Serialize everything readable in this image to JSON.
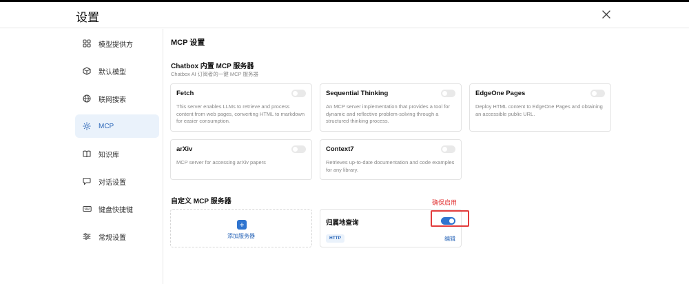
{
  "header": {
    "title": "设置",
    "close_icon": "close-icon"
  },
  "sidebar": {
    "items": [
      {
        "label": "模型提供方",
        "icon": "grid-icon",
        "active": false
      },
      {
        "label": "默认模型",
        "icon": "cube-icon",
        "active": false
      },
      {
        "label": "联网搜索",
        "icon": "globe-icon",
        "active": false
      },
      {
        "label": "MCP",
        "icon": "mcp-icon",
        "active": true
      },
      {
        "label": "知识库",
        "icon": "book-icon",
        "active": false
      },
      {
        "label": "对话设置",
        "icon": "chat-icon",
        "active": false
      },
      {
        "label": "键盘快捷键",
        "icon": "keyboard-icon",
        "active": false
      },
      {
        "label": "常规设置",
        "icon": "sliders-icon",
        "active": false
      }
    ]
  },
  "main": {
    "title": "MCP 设置",
    "builtin": {
      "title": "Chatbox 内置 MCP 服务器",
      "subtitle": "Chatbox AI 订阅者的一键 MCP 服务器",
      "servers": [
        {
          "name": "Fetch",
          "desc": "This server enables LLMs to retrieve and process content from web pages, converting HTML to markdown for easier consumption.",
          "enabled": false
        },
        {
          "name": "Sequential Thinking",
          "desc": "An MCP server implementation that provides a tool for dynamic and reflective problem-solving through a structured thinking process.",
          "enabled": false
        },
        {
          "name": "EdgeOne Pages",
          "desc": "Deploy HTML content to EdgeOne Pages and obtaining an accessible public URL.",
          "enabled": false
        },
        {
          "name": "arXiv",
          "desc": "MCP server for accessing arXiv papers",
          "enabled": false
        },
        {
          "name": "Context7",
          "desc": "Retrieves up-to-date documentation and code examples for any library.",
          "enabled": false
        }
      ]
    },
    "custom": {
      "title": "自定义 MCP 服务器",
      "add_label": "添加服务器",
      "server": {
        "name": "归属地查询",
        "badge": "HTTP",
        "edit_label": "编辑",
        "enabled": true
      }
    },
    "annotation": {
      "text": "确保启用",
      "color": "#e23b3b"
    }
  },
  "colors": {
    "accent": "#2f74cf",
    "active_bg": "#eaf2fb"
  }
}
